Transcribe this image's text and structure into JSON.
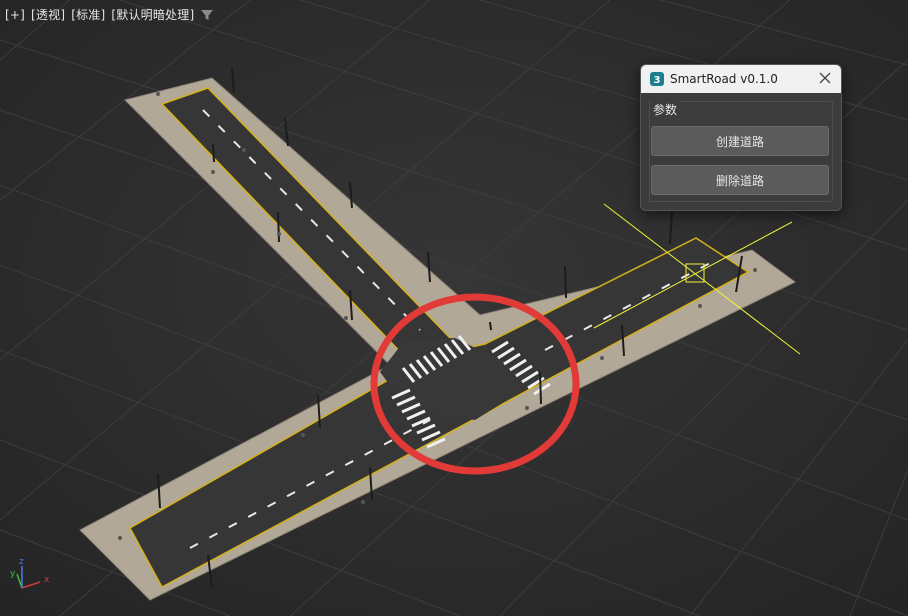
{
  "viewport": {
    "label_plus": "[+]",
    "label_view": "[透视]",
    "label_shading": "[标准]",
    "label_lighting": "[默认明暗处理]",
    "filter_icon": "filter-icon",
    "axis_labels": {
      "x": "x",
      "y": "y",
      "z": "z"
    }
  },
  "dialog": {
    "title": "SmartRoad v0.1.0",
    "app_icon": "3dsmax-icon",
    "close_icon": "close-icon",
    "group_label": "参数",
    "create_button": "创建道路",
    "delete_button": "删除道路"
  },
  "colors": {
    "background": "#2b2b2b",
    "grid": "#3f3f3f",
    "sidewalk": "#b3a99a",
    "asphalt": "#343434",
    "road_edge": "#d4b019",
    "selection": "#f2f23a",
    "highlight_circle": "#e23a36"
  }
}
